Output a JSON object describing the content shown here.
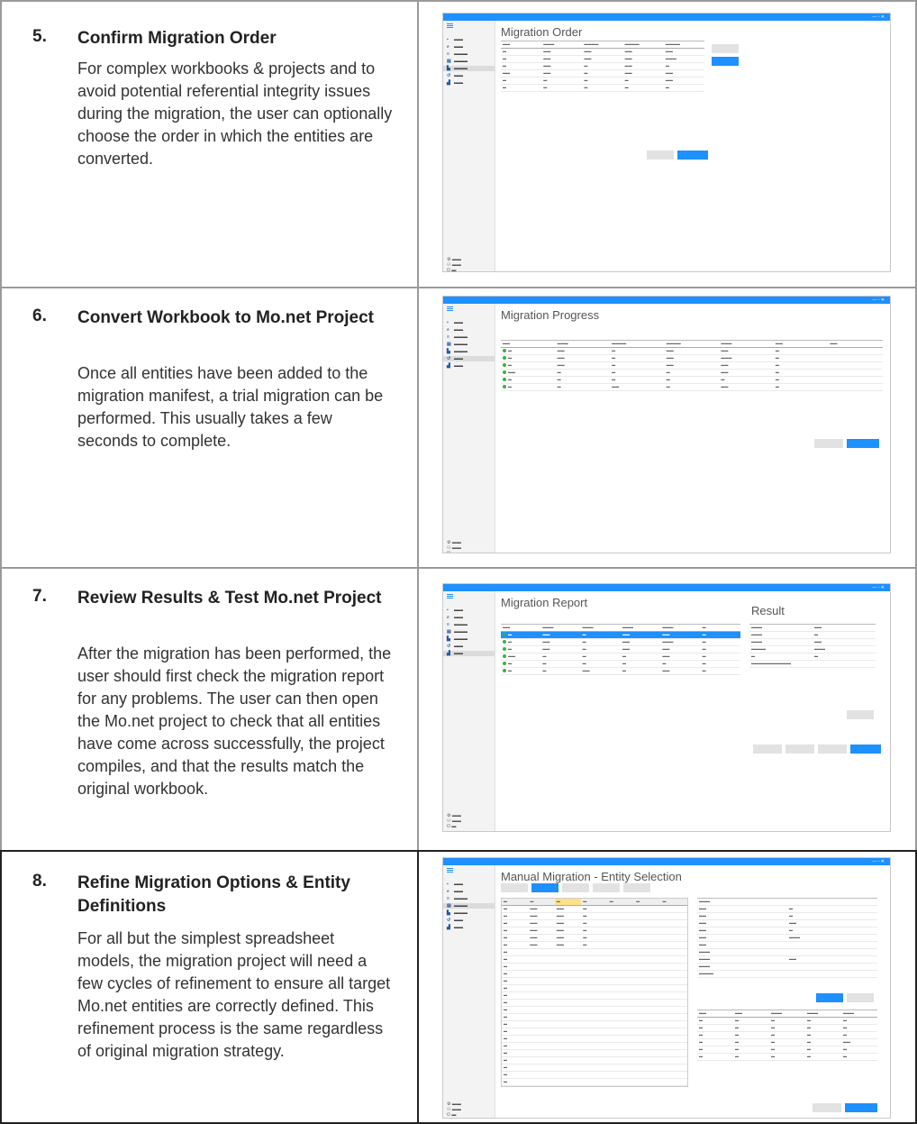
{
  "steps": [
    {
      "number": "5.",
      "title": "Confirm Migration Order",
      "body": "For complex workbooks & projects and to avoid potential referential integrity issues during the migration, the user can optionally choose the order in which the entities are converted."
    },
    {
      "number": "6.",
      "title": "Convert Workbook to Mo.net Project",
      "body": "Once all entities have been added to the migration manifest, a trial migration can be performed.  This usually takes a few seconds to complete."
    },
    {
      "number": "7.",
      "title": "Review Results & Test Mo.net Project",
      "body": "After the migration has been performed, the user should first check the migration report for any problems.  The user can then open the Mo.net project to check that all entities have come across successfully, the project compiles, and that the results match the original workbook."
    },
    {
      "number": "8.",
      "title": "Refine Migration Options & Entity Definitions",
      "body": "For all but the simplest spreadsheet models, the migration project will need a few cycles of refinement to ensure all target Mo.net entities are correctly defined.  This refinement process is the same regardless of original migration strategy."
    }
  ],
  "screenshots": [
    {
      "heading": "Migration Order"
    },
    {
      "heading": "Migration Progress"
    },
    {
      "heading": "Migration Report",
      "side_heading": "Result"
    },
    {
      "heading": "Manual Migration - Entity Selection"
    }
  ],
  "colors": {
    "accent": "#1e90ff",
    "status_ok": "#3cb043",
    "border": "#9a9a9a"
  }
}
